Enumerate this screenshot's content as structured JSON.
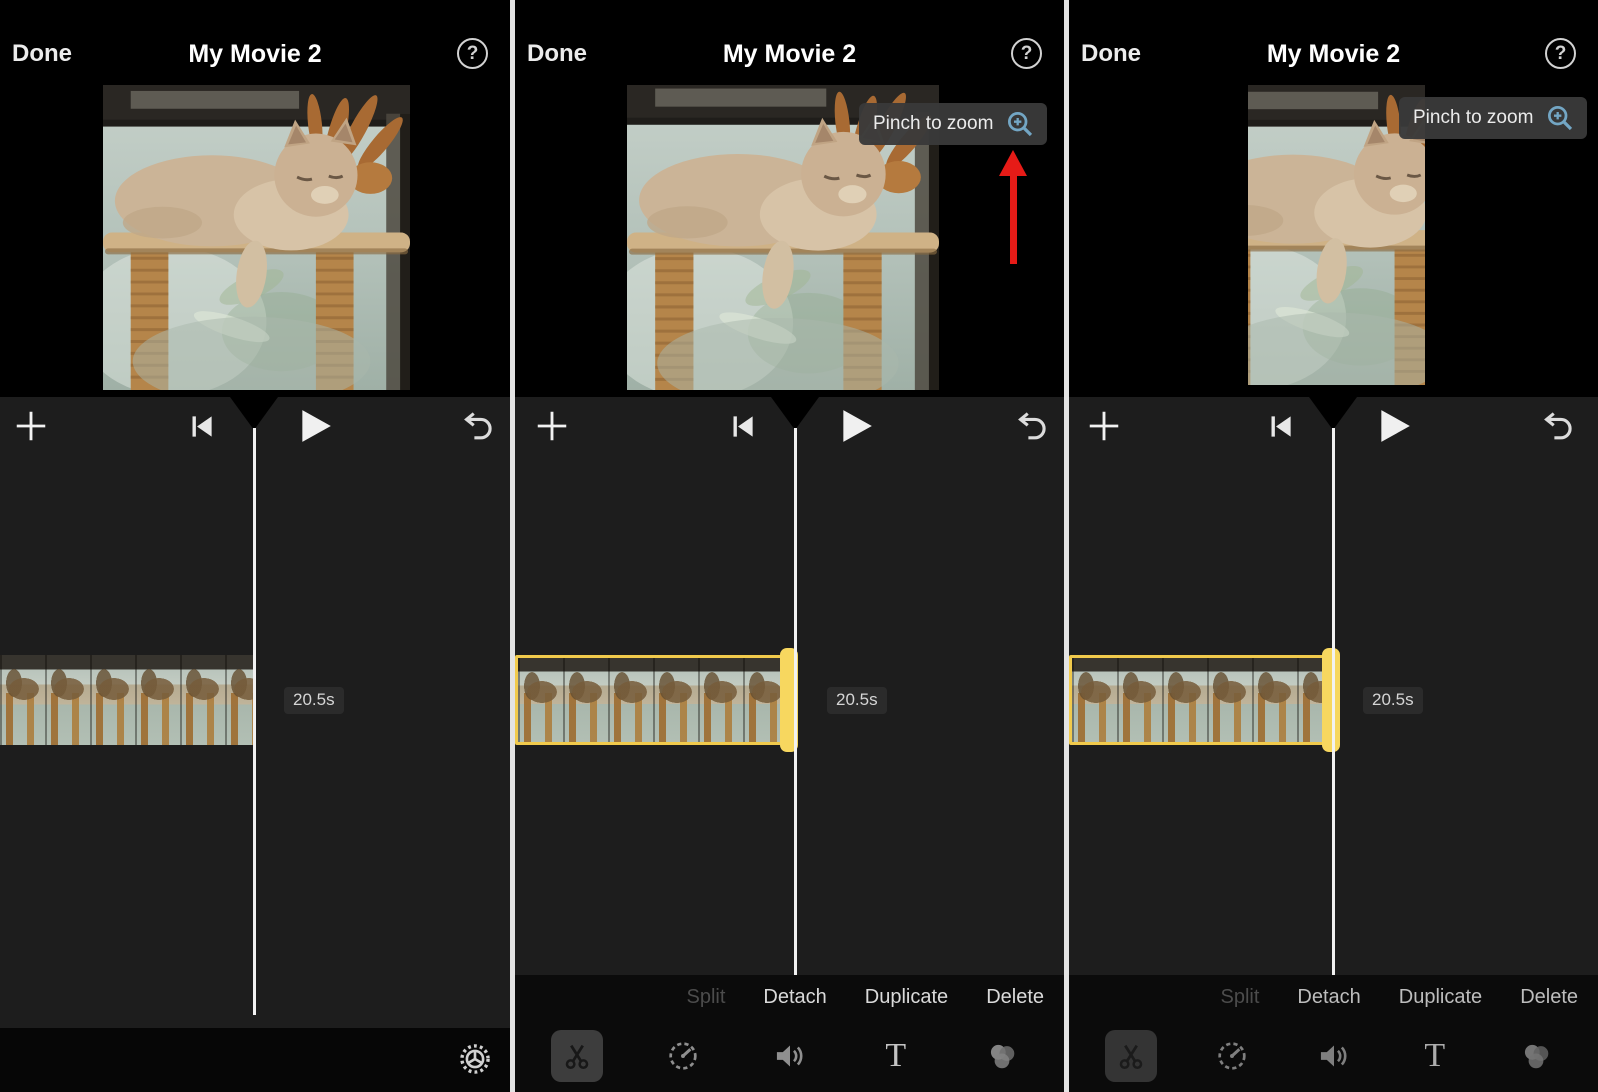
{
  "panels": [
    {
      "header": {
        "done": "Done",
        "title": "My Movie 2",
        "help_glyph": "?",
        "help_icon": "question-mark-circle"
      },
      "timeline": {
        "duration_badge": "20.5s",
        "icons": {
          "add": "plus",
          "skip_start": "skip-to-beginning",
          "play": "play-triangle",
          "undo": "undo-curved-arrow",
          "playhead": "playhead-line"
        }
      },
      "footer": {
        "settings_icon": "gear"
      }
    },
    {
      "header": {
        "done": "Done",
        "title": "My Movie 2",
        "help_glyph": "?",
        "help_icon": "question-mark-circle"
      },
      "overlay": {
        "tooltip_label": "Pinch to zoom",
        "tooltip_icon": "zoom-in-magnifier",
        "annotation_icon": "red-up-arrow"
      },
      "timeline": {
        "duration_badge": "20.5s"
      },
      "toolbar": {
        "actions": {
          "split": "Split",
          "detach": "Detach",
          "duplicate": "Duplicate",
          "delete": "Delete"
        },
        "tools": {
          "scissors": "scissors",
          "speed": "speedometer",
          "volume": "speaker-waves",
          "titles": "letter-T",
          "filters": "overlapping-circles"
        }
      }
    },
    {
      "header": {
        "done": "Done",
        "title": "My Movie 2",
        "help_glyph": "?",
        "help_icon": "question-mark-circle"
      },
      "overlay": {
        "tooltip_label": "Pinch to zoom",
        "tooltip_icon": "zoom-in-magnifier"
      },
      "timeline": {
        "duration_badge": "20.5s"
      },
      "toolbar": {
        "actions": {
          "split": "Split",
          "detach": "Detach",
          "duplicate": "Duplicate",
          "delete": "Delete"
        },
        "tools": {
          "scissors": "scissors",
          "speed": "speedometer",
          "volume": "speaker-waves",
          "titles": "letter-T",
          "filters": "overlapping-circles"
        }
      }
    }
  ],
  "colors": {
    "selection_yellow": "#F1CA4C",
    "annotation_red": "#E61B17",
    "magnifier_blue": "#73A6C4",
    "timeline_bg": "#1D1D1D",
    "toolbar_bg": "#0B0B0B",
    "badge_bg": "#2B2B2B"
  }
}
